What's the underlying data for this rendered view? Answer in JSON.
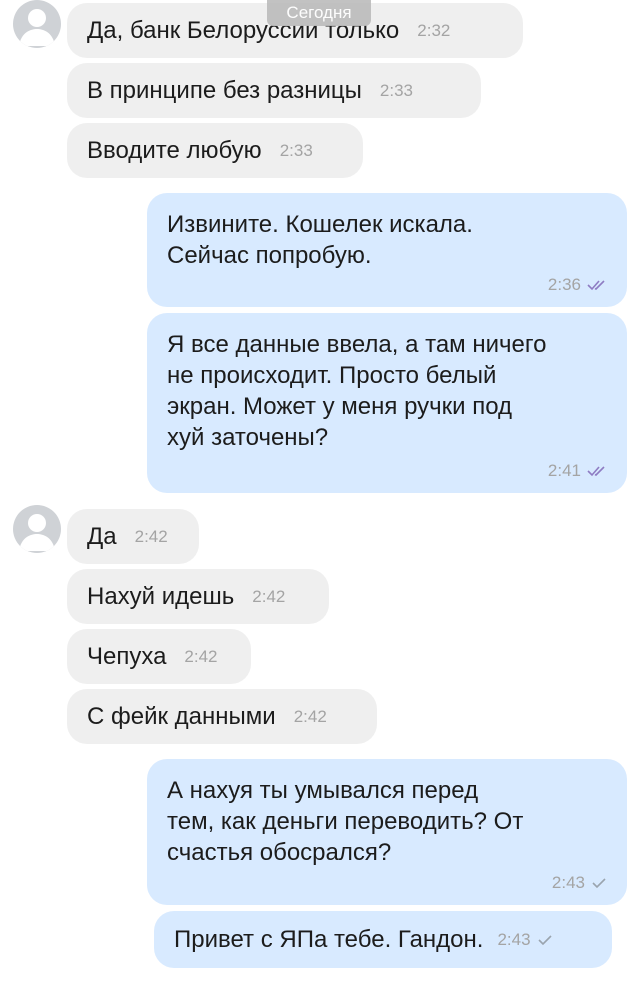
{
  "date_divider": "Сегодня",
  "colors": {
    "incoming_bubble": "#efefef",
    "outgoing_bubble": "#d8eaff",
    "read_check": "#8e7cc3",
    "sent_check": "#9aa4ae"
  },
  "messages": [
    {
      "id": "m1",
      "direction": "incoming",
      "text": "Да, банк Белоруссии только",
      "time": "2:32"
    },
    {
      "id": "m2",
      "direction": "incoming",
      "text": "В принципе без разницы",
      "time": "2:33"
    },
    {
      "id": "m3",
      "direction": "incoming",
      "text": "Вводите любую",
      "time": "2:33"
    },
    {
      "id": "m4",
      "direction": "outgoing",
      "text": "Извините. Кошелек искала.\nСейчас попробую.",
      "time": "2:36",
      "status": "read"
    },
    {
      "id": "m5",
      "direction": "outgoing",
      "text": "Я все данные ввела, а там ничего\nне происходит. Просто белый\nэкран. Может у меня ручки под\nхуй заточены?",
      "time": "2:41",
      "status": "read"
    },
    {
      "id": "m6",
      "direction": "incoming",
      "text": "Да",
      "time": "2:42"
    },
    {
      "id": "m7",
      "direction": "incoming",
      "text": "Нахуй идешь",
      "time": "2:42"
    },
    {
      "id": "m8",
      "direction": "incoming",
      "text": "Чепуха",
      "time": "2:42"
    },
    {
      "id": "m9",
      "direction": "incoming",
      "text": "С фейк данными",
      "time": "2:42"
    },
    {
      "id": "m10",
      "direction": "outgoing",
      "text": "А нахуя ты умывался перед\nтем, как деньги переводить? От\nсчастья обосрался?",
      "time": "2:43",
      "status": "sent"
    },
    {
      "id": "m11",
      "direction": "outgoing",
      "text": "Привет с ЯПа тебе. Гандон.",
      "time": "2:43",
      "status": "sent"
    }
  ]
}
